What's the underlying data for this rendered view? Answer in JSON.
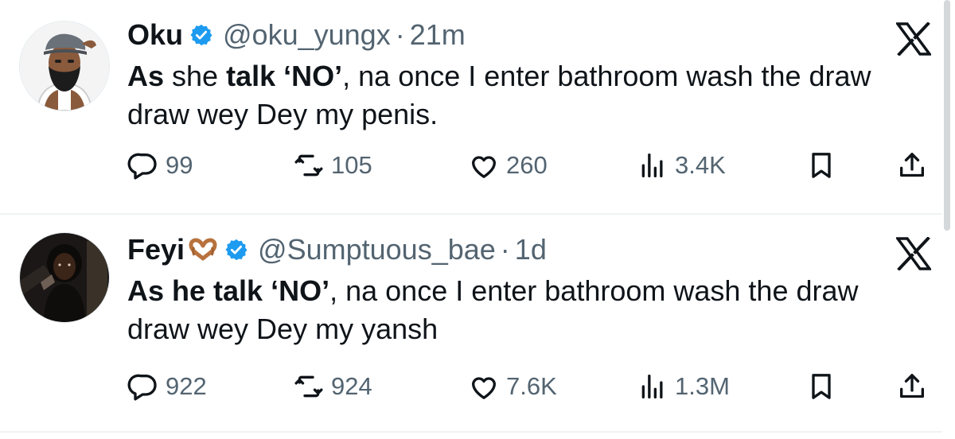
{
  "tweets": [
    {
      "name": "Oku",
      "handle": "@oku_yungx",
      "separator": "·",
      "time": "21m",
      "avatar_icon": "man-with-cap-avatar",
      "text_parts": [
        {
          "text": "As",
          "bold": true
        },
        {
          "text": " she ",
          "bold": false
        },
        {
          "text": "talk",
          "bold": true
        },
        {
          "text": " ",
          "bold": false
        },
        {
          "text": "‘NO’",
          "bold": true
        },
        {
          "text": ", na once I enter bathroom wash the draw\ndraw wey Dey my penis.",
          "bold": false
        }
      ],
      "stats": {
        "replies": "99",
        "reposts": "105",
        "likes": "260",
        "views": "3.4K"
      }
    },
    {
      "name": "Feyi",
      "name_emoji": "heart-hands-emoji",
      "handle": "@Sumptuous_bae",
      "separator": "·",
      "time": "1d",
      "avatar_icon": "woman-portrait-avatar",
      "text_parts": [
        {
          "text": "As he talk",
          "bold": true
        },
        {
          "text": " ",
          "bold": false
        },
        {
          "text": "‘NO’",
          "bold": true
        },
        {
          "text": ", na once I enter bathroom wash the draw\ndraw wey Dey my yansh",
          "bold": false
        }
      ],
      "stats": {
        "replies": "922",
        "reposts": "924",
        "likes": "7.6K",
        "views": "1.3M"
      }
    }
  ],
  "colors": {
    "text": "#0f1419",
    "secondary": "#536471",
    "verified": "#1d9bf0",
    "divider": "#eff3f4"
  },
  "icons": [
    "verified-badge-icon",
    "x-logo-icon",
    "reply-icon",
    "repost-icon",
    "like-icon",
    "views-icon",
    "bookmark-icon",
    "share-icon"
  ]
}
